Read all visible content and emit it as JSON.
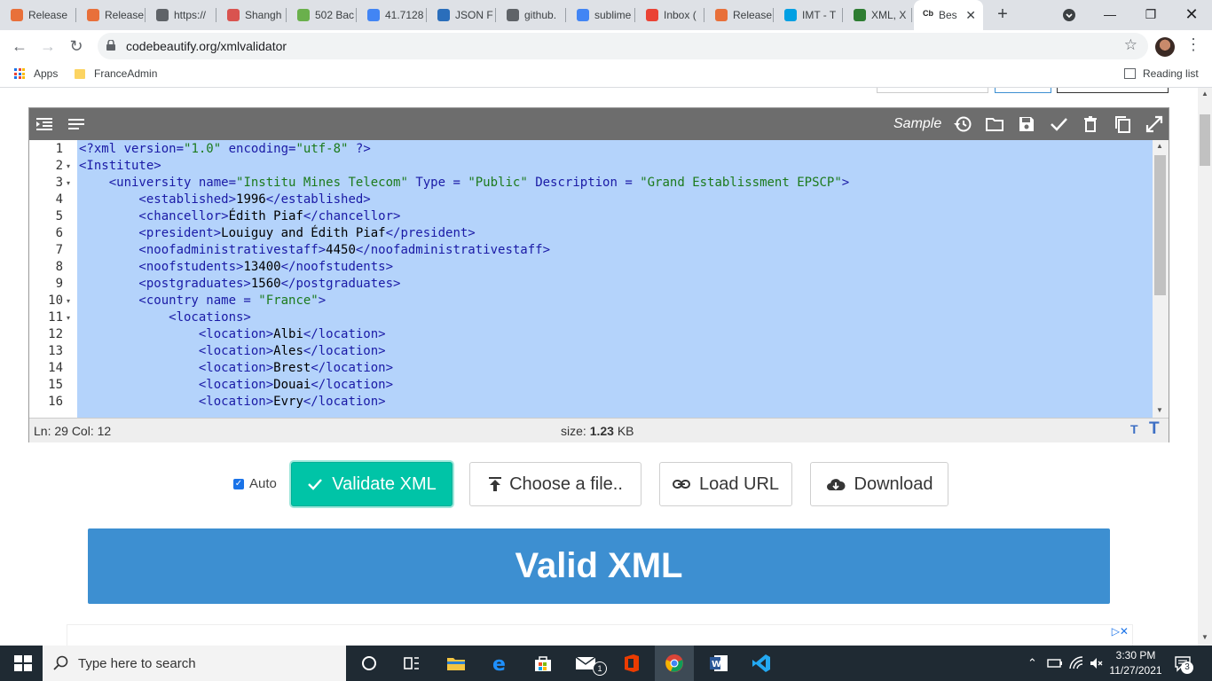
{
  "browser": {
    "tabs": [
      {
        "title": "Release",
        "color": "#e8703a"
      },
      {
        "title": "Release",
        "color": "#e8703a"
      },
      {
        "title": "https://",
        "color": "#5f6368"
      },
      {
        "title": "Shangh",
        "color": "#d9534f"
      },
      {
        "title": "502 Bac",
        "color": "#6ab04c"
      },
      {
        "title": "41.7128",
        "color": "#4285f4"
      },
      {
        "title": "JSON F",
        "color": "#2a6ebb"
      },
      {
        "title": "github.",
        "color": "#5f6368"
      },
      {
        "title": "sublime",
        "color": "#4285f4"
      },
      {
        "title": "Inbox (",
        "color": "#ea4335"
      },
      {
        "title": "Release",
        "color": "#e8703a"
      },
      {
        "title": "IMT - T",
        "color": "#00a0e3"
      },
      {
        "title": "XML, X",
        "color": "#2e7d32"
      },
      {
        "title": "Bes",
        "color": "#222222",
        "fav_text": "Cb",
        "active": true
      }
    ],
    "url": "codebeautify.org/xmlvalidator",
    "bookmarks": {
      "apps": "Apps",
      "folder": "FranceAdmin",
      "reading_list": "Reading list"
    }
  },
  "editor": {
    "sample_label": "Sample",
    "lines": [
      {
        "n": "1",
        "fold": false
      },
      {
        "n": "2",
        "fold": true
      },
      {
        "n": "3",
        "fold": true
      },
      {
        "n": "4",
        "fold": false
      },
      {
        "n": "5",
        "fold": false
      },
      {
        "n": "6",
        "fold": false
      },
      {
        "n": "7",
        "fold": false
      },
      {
        "n": "8",
        "fold": false
      },
      {
        "n": "9",
        "fold": false
      },
      {
        "n": "10",
        "fold": true
      },
      {
        "n": "11",
        "fold": true
      },
      {
        "n": "12",
        "fold": false
      },
      {
        "n": "13",
        "fold": false
      },
      {
        "n": "14",
        "fold": false
      },
      {
        "n": "15",
        "fold": false
      },
      {
        "n": "16",
        "fold": false
      }
    ],
    "code": {
      "l1": {
        "a": "<?xml version=",
        "b": "\"1.0\"",
        "c": " encoding=",
        "d": "\"utf-8\"",
        "e": " ?>"
      },
      "l2": "<Institute>",
      "l3": {
        "a": "    <university name=",
        "b": "\"Institu Mines Telecom\"",
        "c": " Type = ",
        "d": "\"Public\"",
        "e": " Description = ",
        "f": "\"Grand Establissment EPSCP\"",
        "g": ">"
      },
      "l4": {
        "open": "        <established>",
        "val": "1996",
        "close": "</established>"
      },
      "l5": {
        "open": "        <chancellor>",
        "val": "Édith Piaf",
        "close": "</chancellor>"
      },
      "l6": {
        "open": "        <president>",
        "val": "Louiguy and Édith Piaf",
        "close": "</president>"
      },
      "l7": {
        "open": "        <noofadministrativestaff>",
        "val": "4450",
        "close": "</noofadministrativestaff>"
      },
      "l8": {
        "open": "        <noofstudents>",
        "val": "13400",
        "close": "</noofstudents>"
      },
      "l9": {
        "open": "        <postgraduates>",
        "val": "1560",
        "close": "</postgraduates>"
      },
      "l10": {
        "a": "        <country name = ",
        "b": "\"France\"",
        "c": ">"
      },
      "l11": "            <locations>",
      "l12": {
        "open": "                <location>",
        "val": "Albi",
        "close": "</location>"
      },
      "l13": {
        "open": "                <location>",
        "val": "Ales",
        "close": "</location>"
      },
      "l14": {
        "open": "                <location>",
        "val": "Brest",
        "close": "</location>"
      },
      "l15": {
        "open": "                <location>",
        "val": "Douai",
        "close": "</location>"
      },
      "l16": {
        "open": "                <location>",
        "val": "Evry",
        "close": "</location>"
      }
    },
    "status": {
      "position": "Ln: 29 Col: 12",
      "size_label": "size:",
      "size_value": "1.23",
      "size_unit": "KB"
    }
  },
  "actions": {
    "auto_label": "Auto",
    "validate": "Validate XML",
    "choose": "Choose a file..",
    "load_url": "Load URL",
    "download": "Download"
  },
  "result": "Valid XML",
  "taskbar": {
    "search_placeholder": "Type here to search",
    "time": "3:30 PM",
    "date": "11/27/2021",
    "notifications": "3",
    "mail_badge": "1"
  }
}
